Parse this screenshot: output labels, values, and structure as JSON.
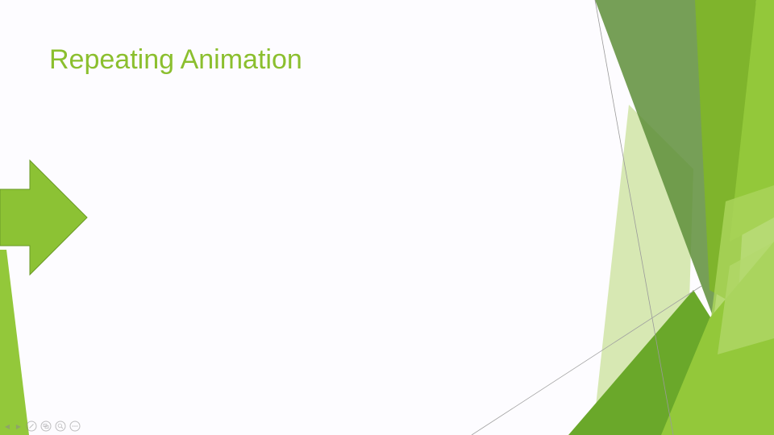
{
  "slide": {
    "title": "Repeating Animation"
  },
  "colors": {
    "title": "#8bbf2e",
    "accent_light": "#93c83a",
    "accent_mid": "#6aa82a",
    "accent_dark": "#5e8e3a",
    "accent_pale": "#c9e29a",
    "background": "#fdfcff"
  },
  "toolbar": {
    "icons": [
      "previous-icon",
      "next-icon",
      "pen-icon",
      "slides-icon",
      "zoom-icon",
      "more-icon"
    ]
  }
}
